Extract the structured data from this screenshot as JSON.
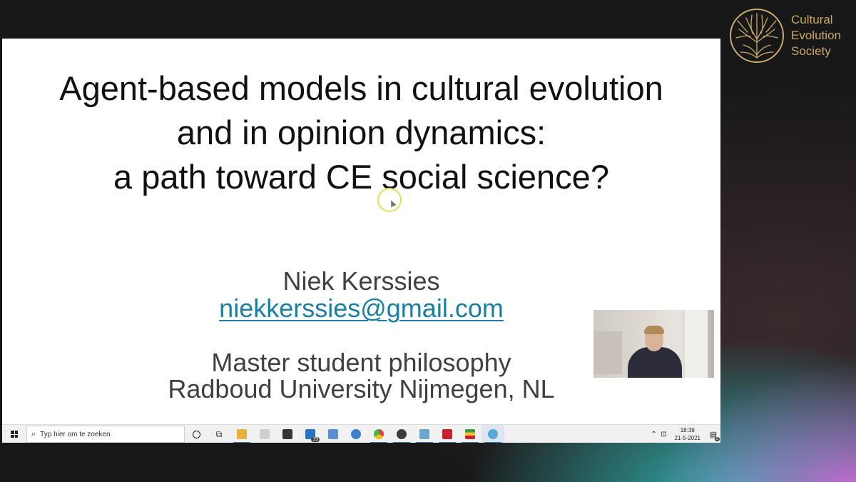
{
  "slide": {
    "title_lines": [
      "Agent-based models in cultural evolution",
      "and in opinion dynamics:",
      "a path toward CE social science?"
    ],
    "author": "Niek Kerssies",
    "email": "niekkerssies@gmail.com",
    "affiliation_lines": [
      "Master student philosophy",
      "Radboud University Nijmegen, NL"
    ]
  },
  "logo": {
    "lines": [
      "Cultural",
      "Evolution",
      "Society"
    ],
    "color": "#c9a96b"
  },
  "taskbar": {
    "search_placeholder": "Typ hier om te zoeken",
    "mail_badge": "19",
    "clock_time": "18:39",
    "clock_date": "21-5-2021",
    "notification_count": "2",
    "apps": [
      {
        "name": "file-explorer-icon",
        "color": "#e8b13a"
      },
      {
        "name": "dropbox-icon",
        "color": "#c9c9c9"
      },
      {
        "name": "store-icon",
        "color": "#333333"
      },
      {
        "name": "mail-icon",
        "color": "#2a74c4"
      },
      {
        "name": "document-icon",
        "color": "#5b8ed0"
      },
      {
        "name": "qbittorrent-icon",
        "color": "#3d7fc9"
      },
      {
        "name": "chrome-icon",
        "color": "#d94a38"
      },
      {
        "name": "wps-icon",
        "color": "#3c3c3c"
      },
      {
        "name": "notes-icon",
        "color": "#6ba7c9"
      },
      {
        "name": "mendeley-icon",
        "color": "#c8202f"
      },
      {
        "name": "flag-icon",
        "color": "#3a9a4a"
      },
      {
        "name": "webex-icon",
        "color": "#55a8d8"
      }
    ]
  }
}
